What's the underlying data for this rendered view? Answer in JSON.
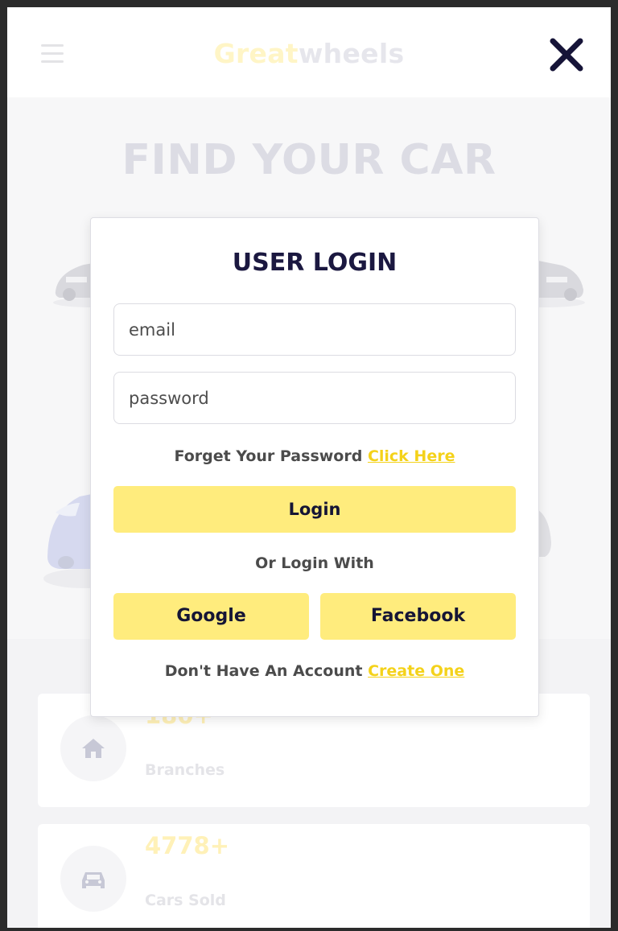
{
  "header": {
    "logo_part1": "Great",
    "logo_part2": "wheels"
  },
  "hero": {
    "title": "FIND YOUR CAR"
  },
  "stats": [
    {
      "value": "180+",
      "label": "Branches",
      "icon": "home-icon"
    },
    {
      "value": "4778+",
      "label": "Cars Sold",
      "icon": "car-icon"
    }
  ],
  "login": {
    "title": "USER LOGIN",
    "email_placeholder": "email",
    "password_placeholder": "password",
    "forgot_text": "Forget Your Password",
    "forgot_link": "Click Here",
    "login_label": "Login",
    "or_text": "Or Login With",
    "google_label": "Google",
    "facebook_label": "Facebook",
    "signup_text": "Don't Have An Account",
    "signup_link": "Create One"
  },
  "colors": {
    "accent": "#ffec7d",
    "link": "#f4d21a",
    "title": "#1b1840"
  }
}
